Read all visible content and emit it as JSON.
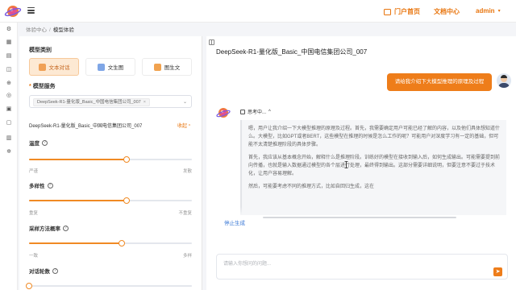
{
  "header": {
    "portal_label": "门户首页",
    "docs_label": "文档中心",
    "user_label": "admin",
    "caret": "▾"
  },
  "breadcrumb": {
    "items": [
      "体验中心",
      "模型体验"
    ],
    "separator": "/"
  },
  "sidebar_icons": [
    "settings-icon",
    "grid-icon",
    "document-icon",
    "chart-icon",
    "upload-icon",
    "link-icon",
    "book-icon",
    "folder-icon",
    "calendar-icon",
    "gear-icon"
  ],
  "left": {
    "model_type_title": "模型类别",
    "modes": [
      {
        "label": "文本对话",
        "icon": "chat-icon",
        "active": true
      },
      {
        "label": "文生图",
        "icon": "image-gen-icon",
        "active": false
      },
      {
        "label": "图生文",
        "icon": "image-to-text-icon",
        "active": false
      }
    ],
    "service_title": "模型服务",
    "service_tag": "DeepSeek-R1-量化版_Basic_中国电信集团公司_007",
    "tag_close": "×",
    "select_arrow": "⌄",
    "model_name": "DeepSeek-R1-量化版_Basic_中国电信集团公司_007",
    "collapse": "收起",
    "params": [
      {
        "label": "温度",
        "help": "?",
        "value": 0.6,
        "min_label": "严谨",
        "max_label": "发散"
      },
      {
        "label": "多样性",
        "help": "?",
        "value": 0.6,
        "min_label": "重复",
        "max_label": "不重复"
      },
      {
        "label": "采样方法概率",
        "help": "?",
        "value": 0.57,
        "min_label": "一致",
        "max_label": "多样"
      },
      {
        "label": "对话轮数",
        "help": "?",
        "value": 0.0,
        "min_label": "",
        "max_label": ""
      }
    ]
  },
  "chat": {
    "title": "DeepSeek-R1-量化版_Basic_中国电信集团公司_007",
    "user_message": "请给我介绍下大模型推理的原理及过程",
    "thinking_label": "思考中...",
    "thinking_caret": "^",
    "thinking_paragraphs": [
      "嗯，用户让我介绍一下大模型推理的原理及过程。首先，我需要确定用户可能已经了解的内容，以及他们具体想知道什么。大模型，比如GPT或者BERT，这些模型在推理的时候是怎么工作的呢？可能用户对深度学习有一定的基础，但可能不太清楚推理阶段的具体步骤。",
      "首先，我应该从基本概念开始，解释什么是推理阶段。训练好的模型在接收到输入后，如何生成输出。可能需要提到前向传播，也就是输入数据通过模型的各个层进行处理，最终得到输出。这部分需要详细说明，但要注意不要过于技术化，让用户容易理解。",
      "然后，可能要考虑不同的推理方式，比如自回归生成，这在"
    ],
    "stop_label": "停止生成",
    "input_placeholder": "请输入你想问的问题...",
    "send_icon": "send-icon"
  },
  "colors": {
    "accent": "#ee7d1a",
    "link": "#3a78d6"
  }
}
